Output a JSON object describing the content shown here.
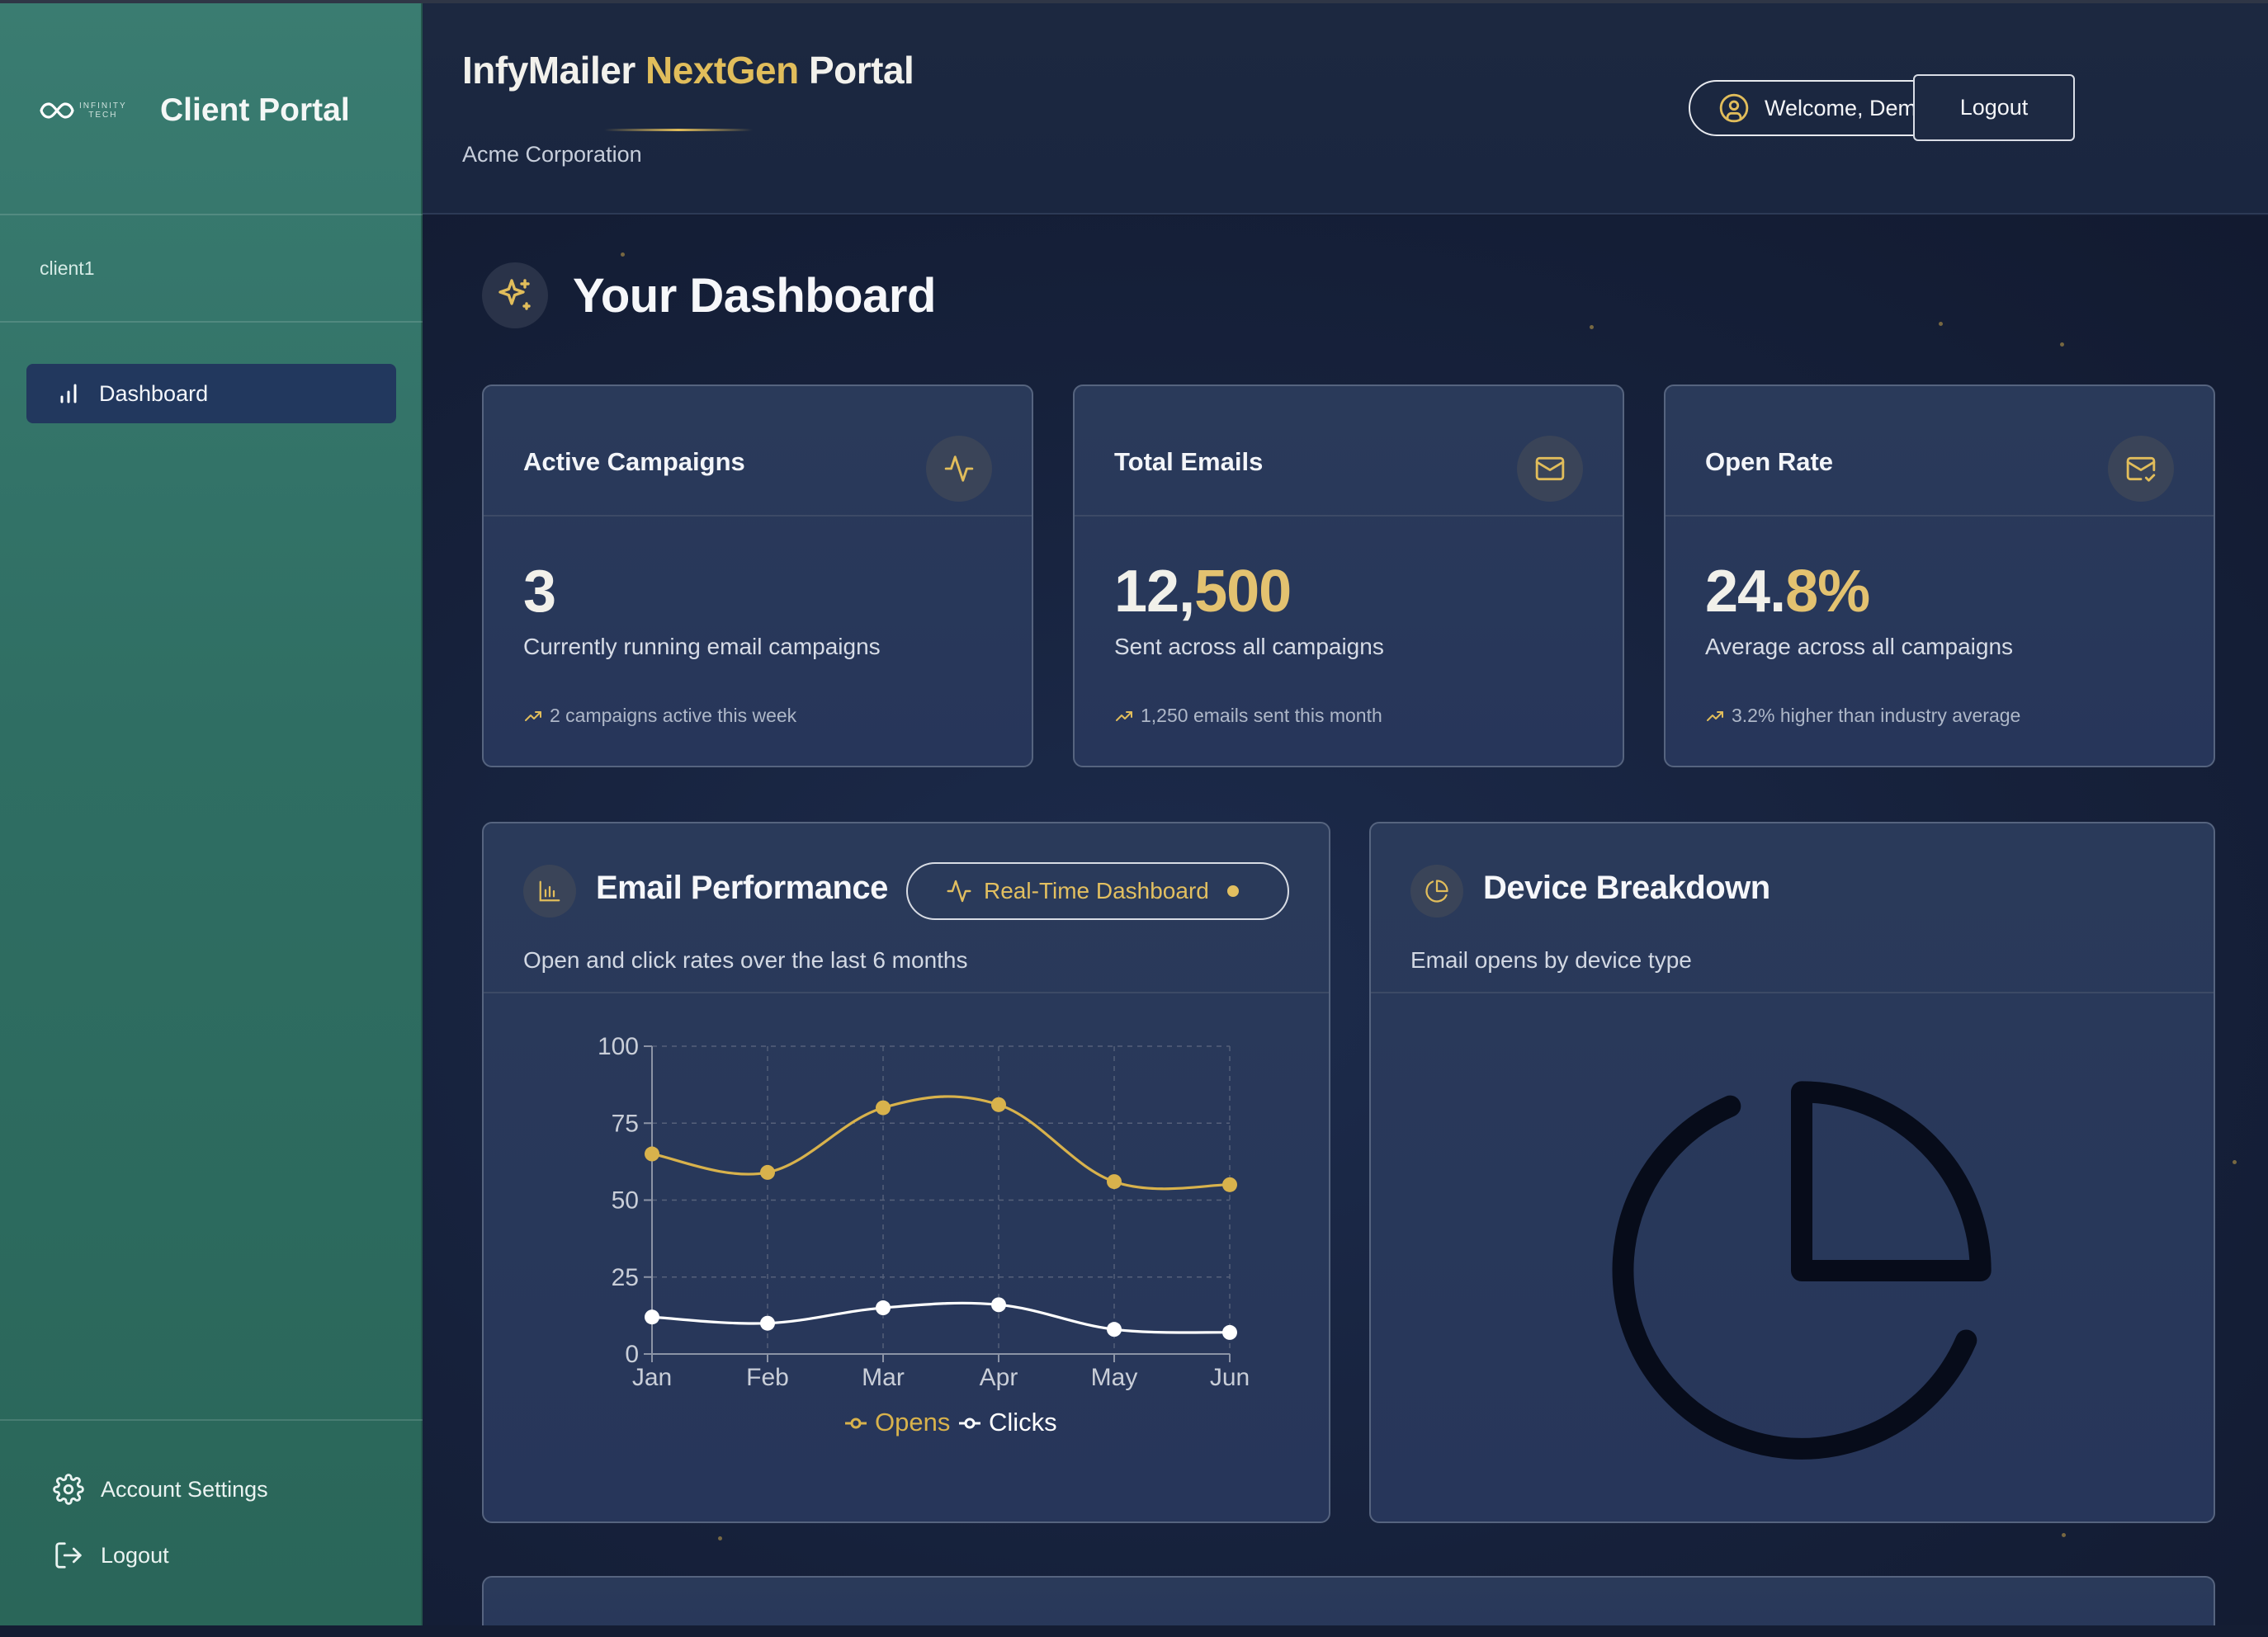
{
  "sidebar": {
    "brand": {
      "logo_text_top": "INFINITY",
      "logo_text_bottom": "TECH",
      "title": "Client Portal"
    },
    "username": "client1",
    "nav": [
      {
        "label": "Dashboard",
        "icon": "bar-chart-icon",
        "active": true
      }
    ],
    "bottom": [
      {
        "label": "Account Settings",
        "icon": "gear-icon"
      },
      {
        "label": "Logout",
        "icon": "logout-icon"
      }
    ]
  },
  "header": {
    "title_part1": "InfyMailer ",
    "title_part2": "NextGen",
    "title_part3": " Portal",
    "company": "Acme Corporation",
    "welcome": "Welcome, Demo Client",
    "logout": "Logout"
  },
  "main": {
    "title": "Your Dashboard",
    "stats": [
      {
        "title": "Active Campaigns",
        "icon": "activity-icon",
        "value_part1": "3",
        "value_part2": "",
        "description": "Currently running email campaigns",
        "footer": "2 campaigns active this week"
      },
      {
        "title": "Total Emails",
        "icon": "mail-icon",
        "value_part1": "12,",
        "value_part2": "500",
        "description": "Sent across all campaigns",
        "footer": "1,250 emails sent this month"
      },
      {
        "title": "Open Rate",
        "icon": "mail-check-icon",
        "value_part1": "24.",
        "value_part2": "8%",
        "description": "Average across all campaigns",
        "footer": "3.2% higher than industry average"
      }
    ],
    "performance": {
      "title": "Email Performance",
      "subtitle": "Open and click rates over the last 6 months",
      "realtime_button": "Real-Time Dashboard"
    },
    "devices": {
      "title": "Device Breakdown",
      "subtitle": "Email opens by device type"
    }
  },
  "colors": {
    "accent_gold": "#e1bd5b",
    "sidebar_green": "#2f6e63",
    "nav_active": "#22385e",
    "opens_line": "#d8b24c",
    "clicks_line": "#ffffff"
  },
  "chart_data": {
    "type": "line",
    "title": "",
    "categories": [
      "Jan",
      "Feb",
      "Mar",
      "Apr",
      "May",
      "Jun"
    ],
    "series": [
      {
        "name": "Opens",
        "values": [
          65,
          59,
          80,
          81,
          56,
          55
        ]
      },
      {
        "name": "Clicks",
        "values": [
          12,
          10,
          15,
          16,
          8,
          7
        ]
      }
    ],
    "ylim": [
      0,
      100
    ],
    "yticks": [
      0,
      25,
      50,
      75,
      100
    ],
    "grid": true,
    "legend": "bottom"
  }
}
